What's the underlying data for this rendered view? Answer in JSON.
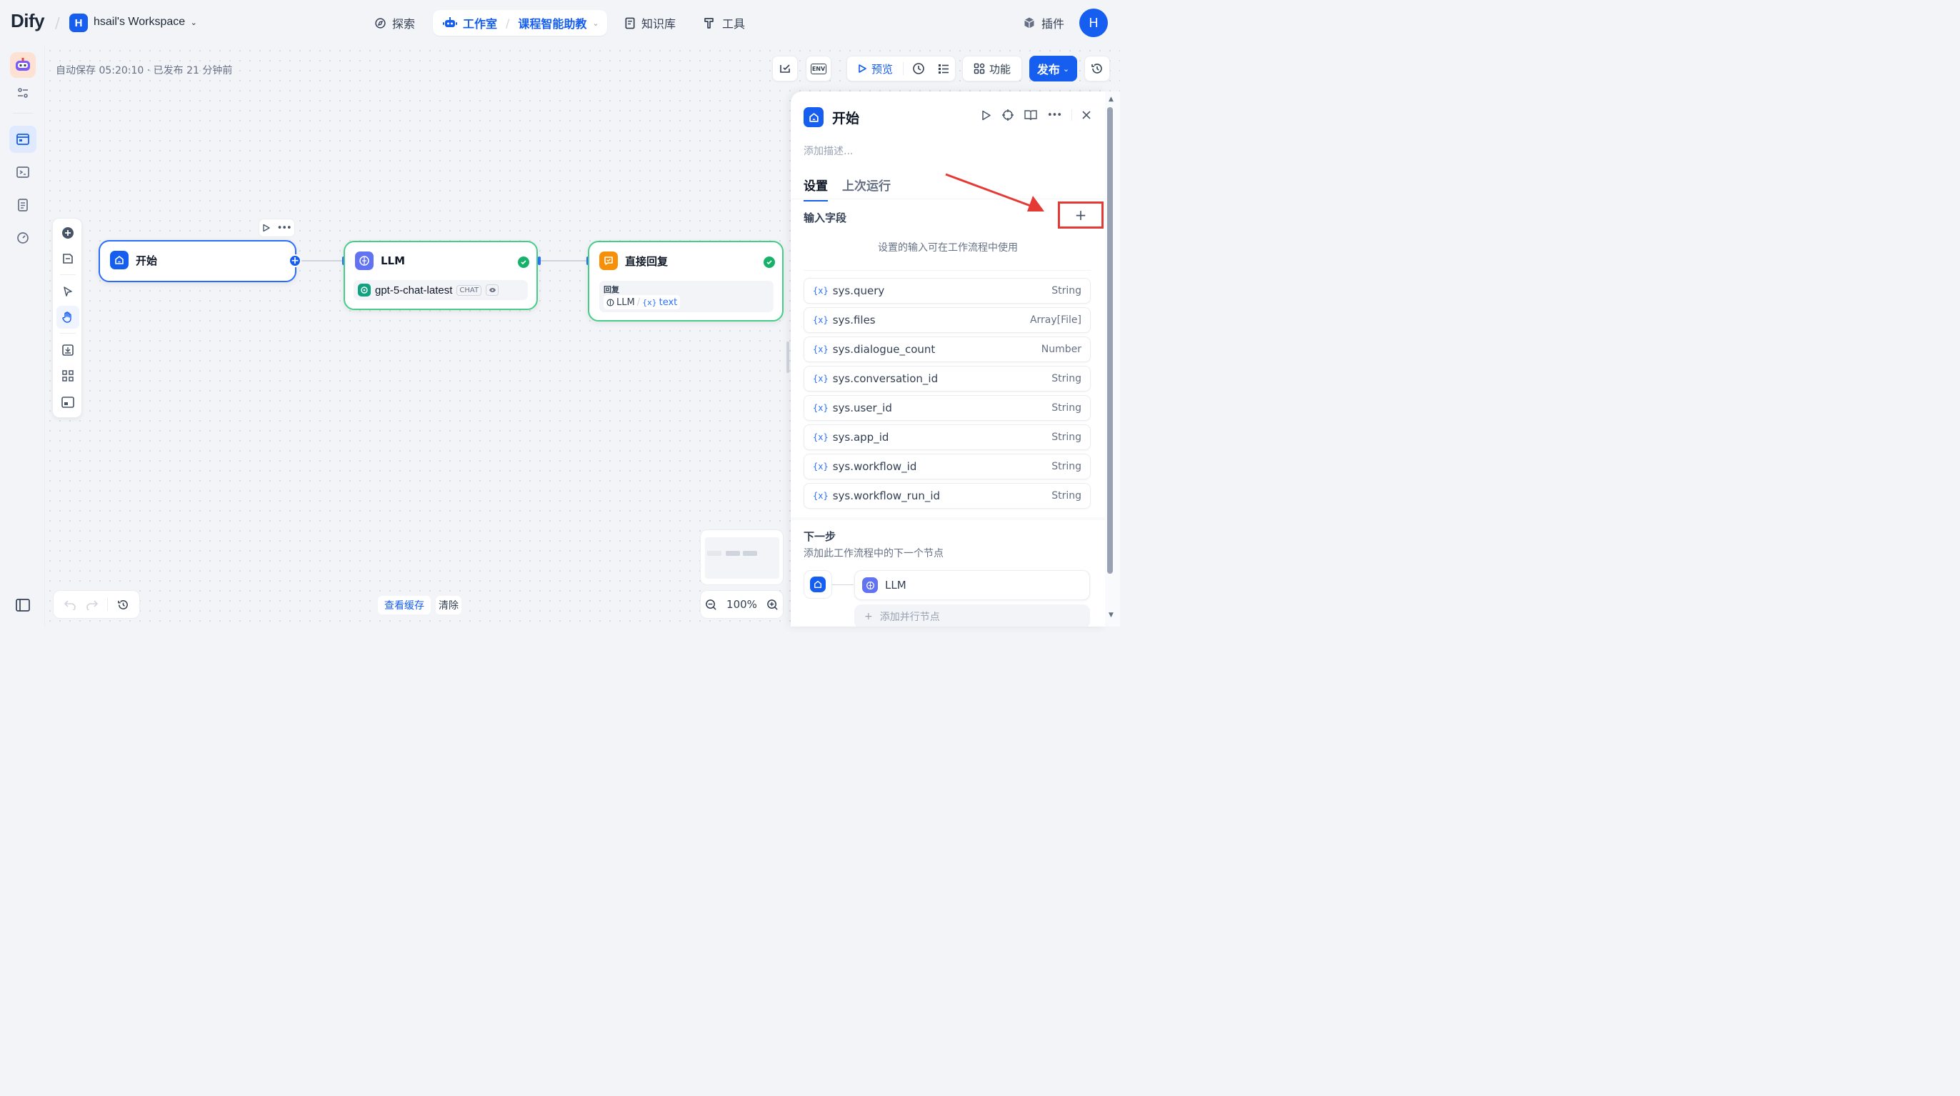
{
  "nav": {
    "logo": "Dify",
    "workspace_initial": "H",
    "workspace_name": "hsail's Workspace",
    "explore": "探索",
    "studio": "工作室",
    "app_name": "课程智能助教",
    "knowledge": "知识库",
    "tools": "工具",
    "plugins": "插件",
    "user_initial": "H"
  },
  "toolbar": {
    "autosave": "自动保存 05:20:10 · 已发布 21 分钟前",
    "env": "ENV",
    "preview": "预览",
    "features": "功能",
    "publish": "发布"
  },
  "nodes": {
    "start": {
      "title": "开始"
    },
    "llm": {
      "title": "LLM",
      "model": "gpt-5-chat-latest",
      "mode": "CHAT"
    },
    "answer": {
      "title": "直接回复",
      "label": "回复",
      "var_node": "LLM",
      "var_name": "text"
    }
  },
  "canvas_footer": {
    "view_cache": "查看缓存",
    "clear": "清除",
    "zoom": "100%"
  },
  "panel": {
    "title": "开始",
    "description_placeholder": "添加描述...",
    "tabs": [
      "设置",
      "上次运行"
    ],
    "input_fields_title": "输入字段",
    "add_label": "+",
    "hint": "设置的输入可在工作流程中使用",
    "variables": [
      {
        "name": "sys.query",
        "type": "String"
      },
      {
        "name": "sys.files",
        "type": "Array[File]"
      },
      {
        "name": "sys.dialogue_count",
        "type": "Number"
      },
      {
        "name": "sys.conversation_id",
        "type": "String"
      },
      {
        "name": "sys.user_id",
        "type": "String"
      },
      {
        "name": "sys.app_id",
        "type": "String"
      },
      {
        "name": "sys.workflow_id",
        "type": "String"
      },
      {
        "name": "sys.workflow_run_id",
        "type": "String"
      }
    ],
    "next_title": "下一步",
    "next_desc": "添加此工作流程中的下一个节点",
    "next_node": "LLM",
    "add_parallel": "添加并行节点"
  },
  "colors": {
    "primary": "#155eef",
    "success": "#17b26a",
    "answer_node": "#f79009",
    "highlight": "#e53935"
  }
}
